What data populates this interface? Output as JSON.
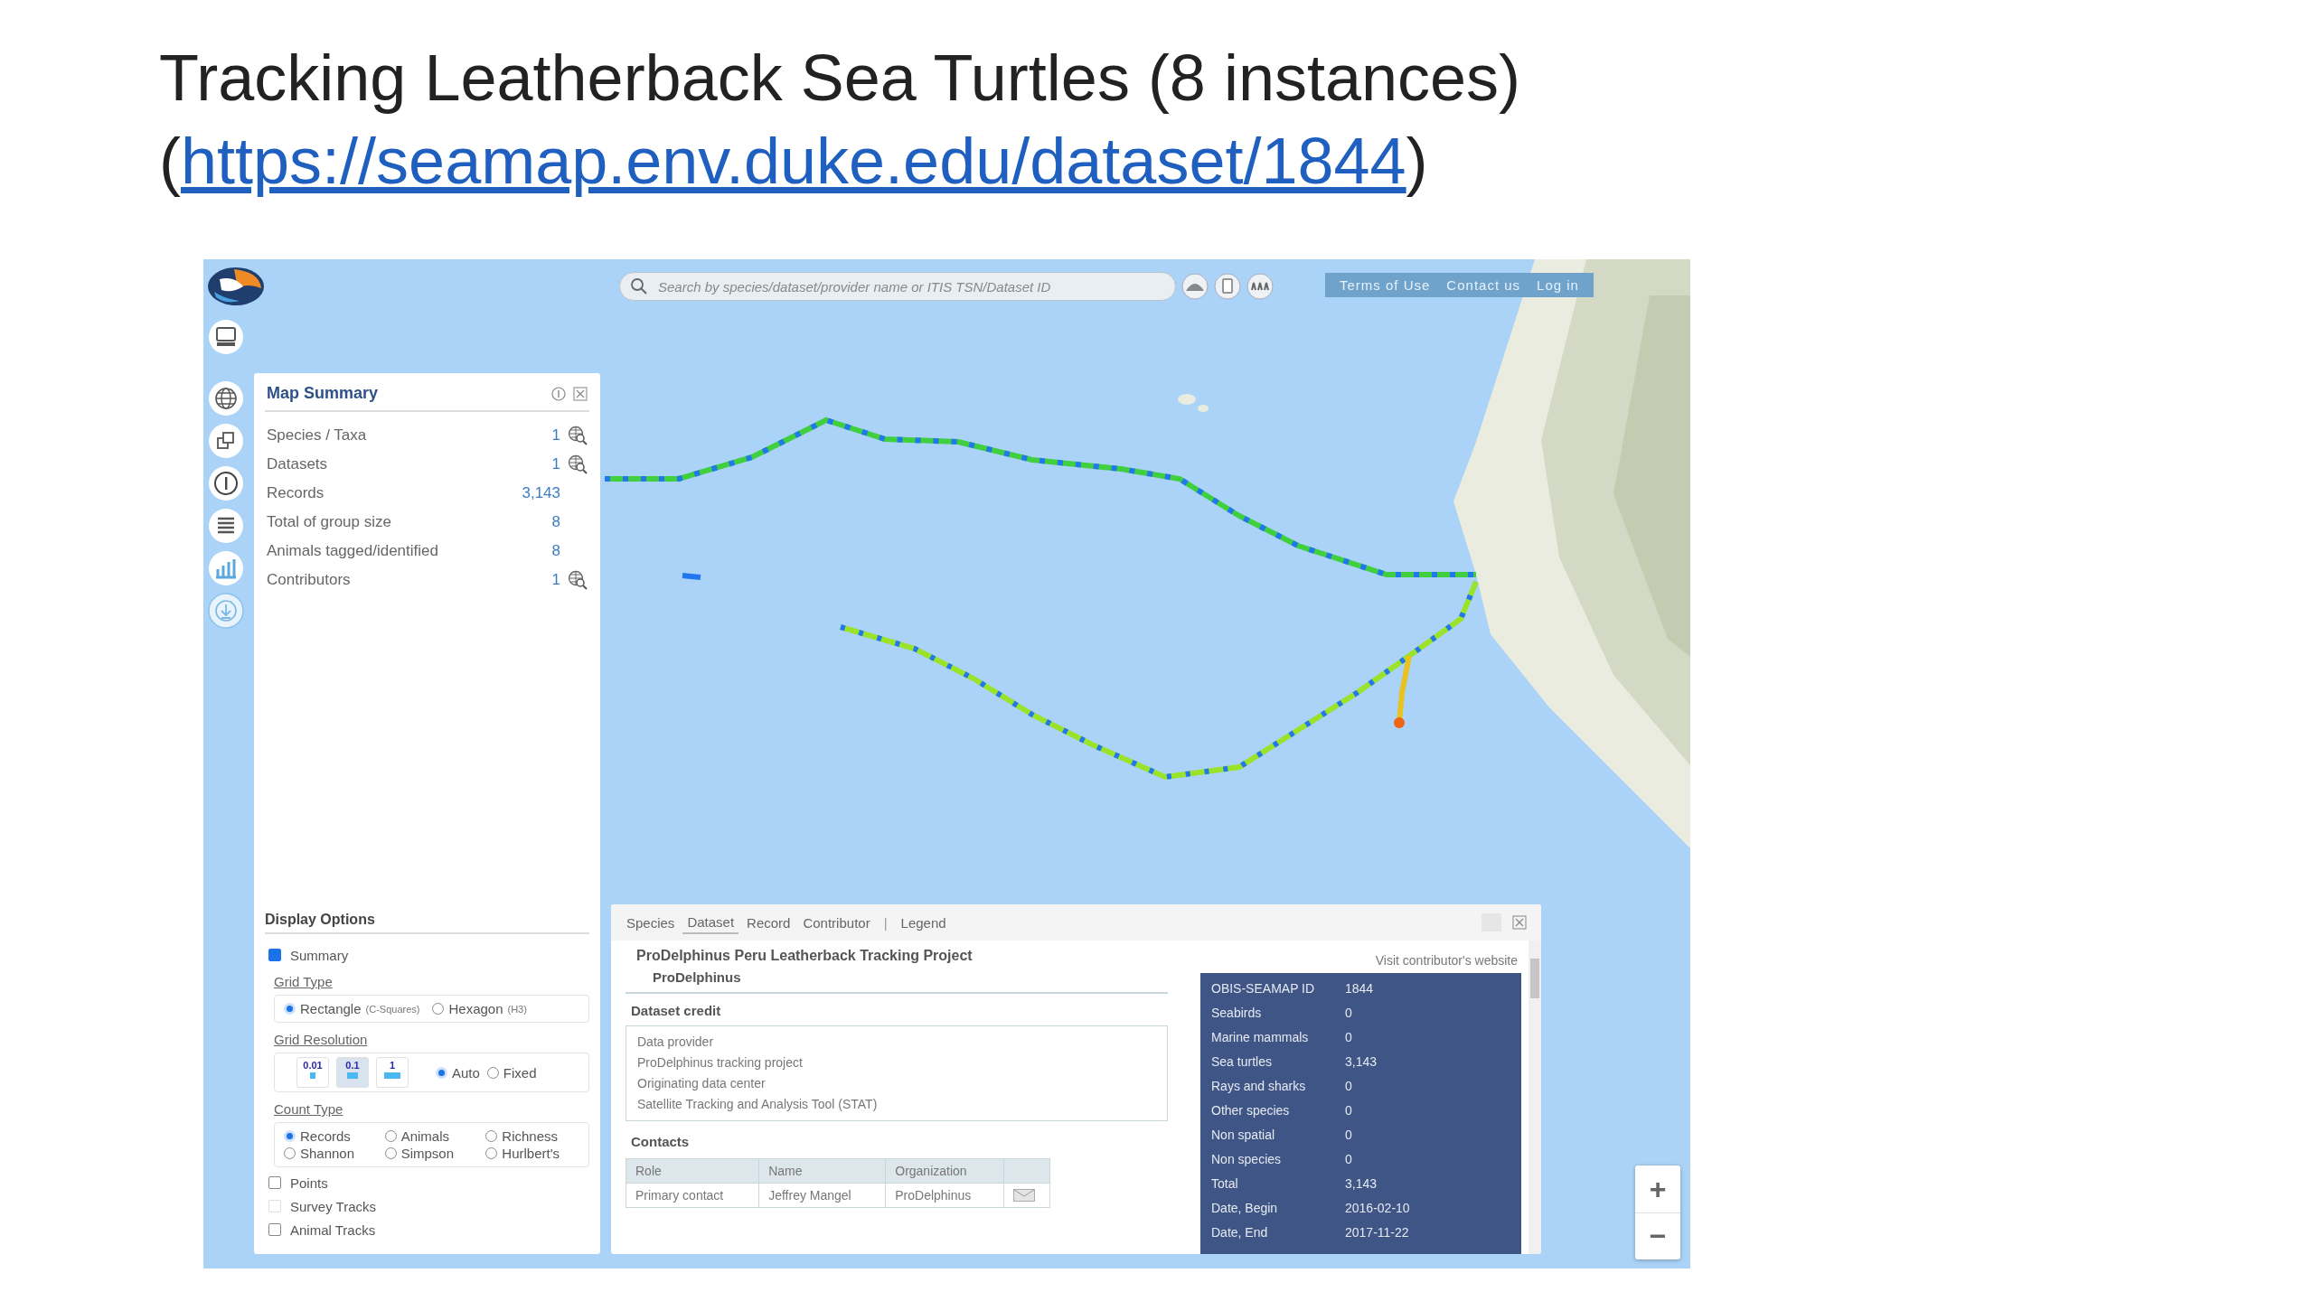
{
  "slide": {
    "title": "Tracking Leatherback Sea Turtles (8 instances)",
    "link_prefix": "(",
    "link": "https://seamap.env.duke.edu/dataset/1844",
    "link_suffix": ")"
  },
  "app": {
    "search": {
      "placeholder": "Search by species/dataset/provider name or ITIS TSN/Dataset ID"
    },
    "top_links": [
      "Terms of Use",
      "Contact us",
      "Log in"
    ],
    "map_summary": {
      "title": "Map Summary",
      "rows": [
        {
          "label": "Species / Taxa",
          "value": "1",
          "has_search": true
        },
        {
          "label": "Datasets",
          "value": "1",
          "has_search": true
        },
        {
          "label": "Records",
          "value": "3,143",
          "has_search": false
        },
        {
          "label": "Total of group size",
          "value": "8",
          "has_search": false
        },
        {
          "label": "Animals tagged/identified",
          "value": "8",
          "has_search": false
        },
        {
          "label": "Contributors",
          "value": "1",
          "has_search": true
        }
      ]
    },
    "display_options": {
      "title": "Display Options",
      "summary": {
        "label": "Summary",
        "checked": true
      },
      "grid_type": {
        "label": "Grid Type",
        "options": [
          {
            "label": "Rectangle",
            "note": "(C-Squares)",
            "selected": true
          },
          {
            "label": "Hexagon",
            "note": "(H3)",
            "selected": false
          }
        ]
      },
      "grid_resolution": {
        "label": "Grid Resolution",
        "buttons": [
          {
            "label": "0.01",
            "selected": false
          },
          {
            "label": "0.1",
            "selected": true
          },
          {
            "label": "1",
            "selected": false
          }
        ],
        "modes": [
          {
            "label": "Auto",
            "selected": true
          },
          {
            "label": "Fixed",
            "selected": false
          }
        ]
      },
      "count_type": {
        "label": "Count Type",
        "options": [
          {
            "label": "Records",
            "selected": true
          },
          {
            "label": "Animals",
            "selected": false
          },
          {
            "label": "Richness",
            "selected": false
          },
          {
            "label": "Shannon",
            "selected": false
          },
          {
            "label": "Simpson",
            "selected": false
          },
          {
            "label": "Hurlbert's",
            "selected": false
          }
        ]
      },
      "layers": [
        {
          "label": "Points",
          "checked": false,
          "disabled": false
        },
        {
          "label": "Survey Tracks",
          "checked": false,
          "disabled": true
        },
        {
          "label": "Animal Tracks",
          "checked": false,
          "disabled": false
        }
      ]
    },
    "info_panel": {
      "tabs": [
        {
          "label": "Species",
          "selected": false
        },
        {
          "label": "Dataset",
          "selected": true
        },
        {
          "label": "Record",
          "selected": false
        },
        {
          "label": "Contributor",
          "selected": false
        }
      ],
      "tab_separator": "|",
      "extra_tabs": [
        {
          "label": "Legend",
          "selected": false
        }
      ],
      "dataset_title": "ProDelphinus Peru Leatherback Tracking Project",
      "provider": "ProDelphinus",
      "website_link": "Visit contributor's website",
      "credit_heading": "Dataset credit",
      "credit_lines": [
        "Data provider",
        "ProDelphinus tracking project",
        "Originating data center",
        "Satellite Tracking and Analysis Tool (STAT)"
      ],
      "contacts_heading": "Contacts",
      "contacts_columns": [
        "Role",
        "Name",
        "Organization"
      ],
      "contacts_rows": [
        {
          "cells": [
            "Primary contact",
            "Jeffrey Mangel",
            "ProDelphinus"
          ],
          "has_email": true
        }
      ],
      "stats": [
        {
          "label": "OBIS-SEAMAP ID",
          "value": "1844"
        },
        {
          "label": "Seabirds",
          "value": "0"
        },
        {
          "label": "Marine mammals",
          "value": "0"
        },
        {
          "label": "Sea turtles",
          "value": "3,143"
        },
        {
          "label": "Rays and sharks",
          "value": "0"
        },
        {
          "label": "Other species",
          "value": "0"
        },
        {
          "label": "Non spatial",
          "value": "0"
        },
        {
          "label": "Non species",
          "value": "0"
        },
        {
          "label": "Total",
          "value": "3,143"
        },
        {
          "label": "Date, Begin",
          "value": "2016-02-10"
        },
        {
          "label": "Date, End",
          "value": "2017-11-22"
        }
      ]
    },
    "zoom_controls": [
      "+",
      "−"
    ]
  }
}
